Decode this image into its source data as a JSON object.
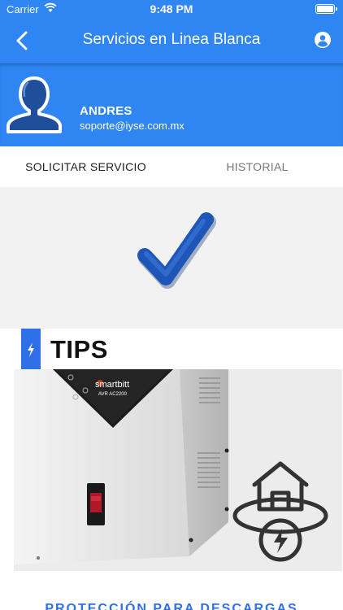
{
  "status_bar": {
    "carrier": "Carrier",
    "time": "9:48 PM"
  },
  "nav": {
    "title": "Servicios en Linea Blanca"
  },
  "profile": {
    "name": "ANDRES",
    "email": "soporte@iyse.com.mx"
  },
  "tabs": [
    {
      "label": "SOLICITAR SERVICIO",
      "active": true
    },
    {
      "label": "HISTORIAL",
      "active": false
    }
  ],
  "tips": {
    "title": "TIPS",
    "banner": {
      "brand": "smartbitt",
      "model": "AVR AC2200",
      "caption": "PROTECCIÓN PARA DESCARGAS ELÉCTRICAS"
    }
  },
  "colors": {
    "primary": "#2f86f3",
    "accent": "#2f6fe8",
    "check": "#1e56b8"
  }
}
